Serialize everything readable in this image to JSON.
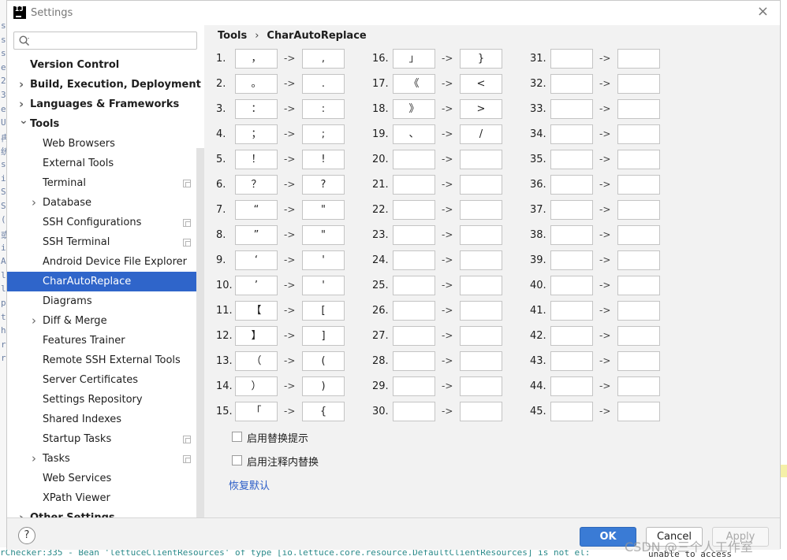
{
  "window": {
    "title": "Settings",
    "close_glyph": "×"
  },
  "search": {
    "placeholder": "",
    "value": ""
  },
  "sidebar": {
    "items": [
      {
        "label": "Version Control",
        "level": 0,
        "expandable": false,
        "top": true
      },
      {
        "label": "Build, Execution, Deployment",
        "level": 0,
        "expandable": true,
        "expanded": false,
        "top": true
      },
      {
        "label": "Languages & Frameworks",
        "level": 0,
        "expandable": true,
        "expanded": false,
        "top": true
      },
      {
        "label": "Tools",
        "level": 0,
        "expandable": true,
        "expanded": true,
        "top": true
      },
      {
        "label": "Web Browsers",
        "level": 1
      },
      {
        "label": "External Tools",
        "level": 1
      },
      {
        "label": "Terminal",
        "level": 1,
        "config": true
      },
      {
        "label": "Database",
        "level": 1,
        "expandable": true,
        "expanded": false
      },
      {
        "label": "SSH Configurations",
        "level": 1,
        "config": true
      },
      {
        "label": "SSH Terminal",
        "level": 1,
        "config": true
      },
      {
        "label": "Android Device File Explorer",
        "level": 1
      },
      {
        "label": "CharAutoReplace",
        "level": 1,
        "selected": true
      },
      {
        "label": "Diagrams",
        "level": 1
      },
      {
        "label": "Diff & Merge",
        "level": 1,
        "expandable": true,
        "expanded": false
      },
      {
        "label": "Features Trainer",
        "level": 1
      },
      {
        "label": "Remote SSH External Tools",
        "level": 1
      },
      {
        "label": "Server Certificates",
        "level": 1
      },
      {
        "label": "Settings Repository",
        "level": 1
      },
      {
        "label": "Shared Indexes",
        "level": 1
      },
      {
        "label": "Startup Tasks",
        "level": 1,
        "config": true
      },
      {
        "label": "Tasks",
        "level": 1,
        "expandable": true,
        "expanded": false,
        "config": true
      },
      {
        "label": "Web Services",
        "level": 1
      },
      {
        "label": "XPath Viewer",
        "level": 1
      },
      {
        "label": "Other Settings",
        "level": 0,
        "expandable": true,
        "expanded": false,
        "top": true
      }
    ]
  },
  "breadcrumb": {
    "parent": "Tools",
    "separator": "›",
    "current": "CharAutoReplace"
  },
  "arrow_text": "->",
  "replace_rows": [
    {
      "num": "1.",
      "from": "，",
      "to": ","
    },
    {
      "num": "2.",
      "from": "。",
      "to": "."
    },
    {
      "num": "3.",
      "from": "：",
      "to": ":"
    },
    {
      "num": "4.",
      "from": "；",
      "to": ";"
    },
    {
      "num": "5.",
      "from": "！",
      "to": "!"
    },
    {
      "num": "6.",
      "from": "？",
      "to": "?"
    },
    {
      "num": "7.",
      "from": "“",
      "to": "\""
    },
    {
      "num": "8.",
      "from": "”",
      "to": "\""
    },
    {
      "num": "9.",
      "from": "‘",
      "to": "'"
    },
    {
      "num": "10.",
      "from": "’",
      "to": "'"
    },
    {
      "num": "11.",
      "from": "【",
      "to": "["
    },
    {
      "num": "12.",
      "from": "】",
      "to": "]"
    },
    {
      "num": "13.",
      "from": "（",
      "to": "("
    },
    {
      "num": "14.",
      "from": "）",
      "to": ")"
    },
    {
      "num": "15.",
      "from": "「",
      "to": "{"
    },
    {
      "num": "16.",
      "from": "」",
      "to": "}"
    },
    {
      "num": "17.",
      "from": "《",
      "to": "<"
    },
    {
      "num": "18.",
      "from": "》",
      "to": ">"
    },
    {
      "num": "19.",
      "from": "、",
      "to": "/"
    },
    {
      "num": "20.",
      "from": "",
      "to": ""
    },
    {
      "num": "21.",
      "from": "",
      "to": ""
    },
    {
      "num": "22.",
      "from": "",
      "to": ""
    },
    {
      "num": "23.",
      "from": "",
      "to": ""
    },
    {
      "num": "24.",
      "from": "",
      "to": ""
    },
    {
      "num": "25.",
      "from": "",
      "to": ""
    },
    {
      "num": "26.",
      "from": "",
      "to": ""
    },
    {
      "num": "27.",
      "from": "",
      "to": ""
    },
    {
      "num": "28.",
      "from": "",
      "to": ""
    },
    {
      "num": "29.",
      "from": "",
      "to": ""
    },
    {
      "num": "30.",
      "from": "",
      "to": ""
    },
    {
      "num": "31.",
      "from": "",
      "to": ""
    },
    {
      "num": "32.",
      "from": "",
      "to": ""
    },
    {
      "num": "33.",
      "from": "",
      "to": ""
    },
    {
      "num": "34.",
      "from": "",
      "to": ""
    },
    {
      "num": "35.",
      "from": "",
      "to": ""
    },
    {
      "num": "36.",
      "from": "",
      "to": ""
    },
    {
      "num": "37.",
      "from": "",
      "to": ""
    },
    {
      "num": "38.",
      "from": "",
      "to": ""
    },
    {
      "num": "39.",
      "from": "",
      "to": ""
    },
    {
      "num": "40.",
      "from": "",
      "to": ""
    },
    {
      "num": "41.",
      "from": "",
      "to": ""
    },
    {
      "num": "42.",
      "from": "",
      "to": ""
    },
    {
      "num": "43.",
      "from": "",
      "to": ""
    },
    {
      "num": "44.",
      "from": "",
      "to": ""
    },
    {
      "num": "45.",
      "from": "",
      "to": ""
    }
  ],
  "options": {
    "enable_hint": {
      "label": "启用替换提示",
      "checked": false
    },
    "enable_in_comment": {
      "label": "启用注释内替换",
      "checked": false
    }
  },
  "restore_default": "恢复默认",
  "footer": {
    "help": "?",
    "ok": "OK",
    "cancel": "Cancel",
    "apply": "Apply"
  },
  "background": {
    "bottom_code": "rChecker:335 - Bean 'lettuceClientResources' of type [io.lettuce.core.resource.DefaultClientResources] is not el:",
    "right_code": "unable to access",
    "left_chars": [
      "s",
      "s",
      "s",
      "e",
      "2",
      "3",
      "e",
      "U",
      "冉",
      "统",
      "s",
      "i",
      "S",
      "S",
      "(",
      "或",
      "is",
      "A",
      "l",
      "l",
      "p",
      "t",
      "h",
      "r",
      "r"
    ]
  },
  "watermark": "CSDN @三个人工作室",
  "colors": {
    "selection": "#2f65ca",
    "ok_button": "#3a7bd5",
    "link": "#2a5cc7"
  }
}
